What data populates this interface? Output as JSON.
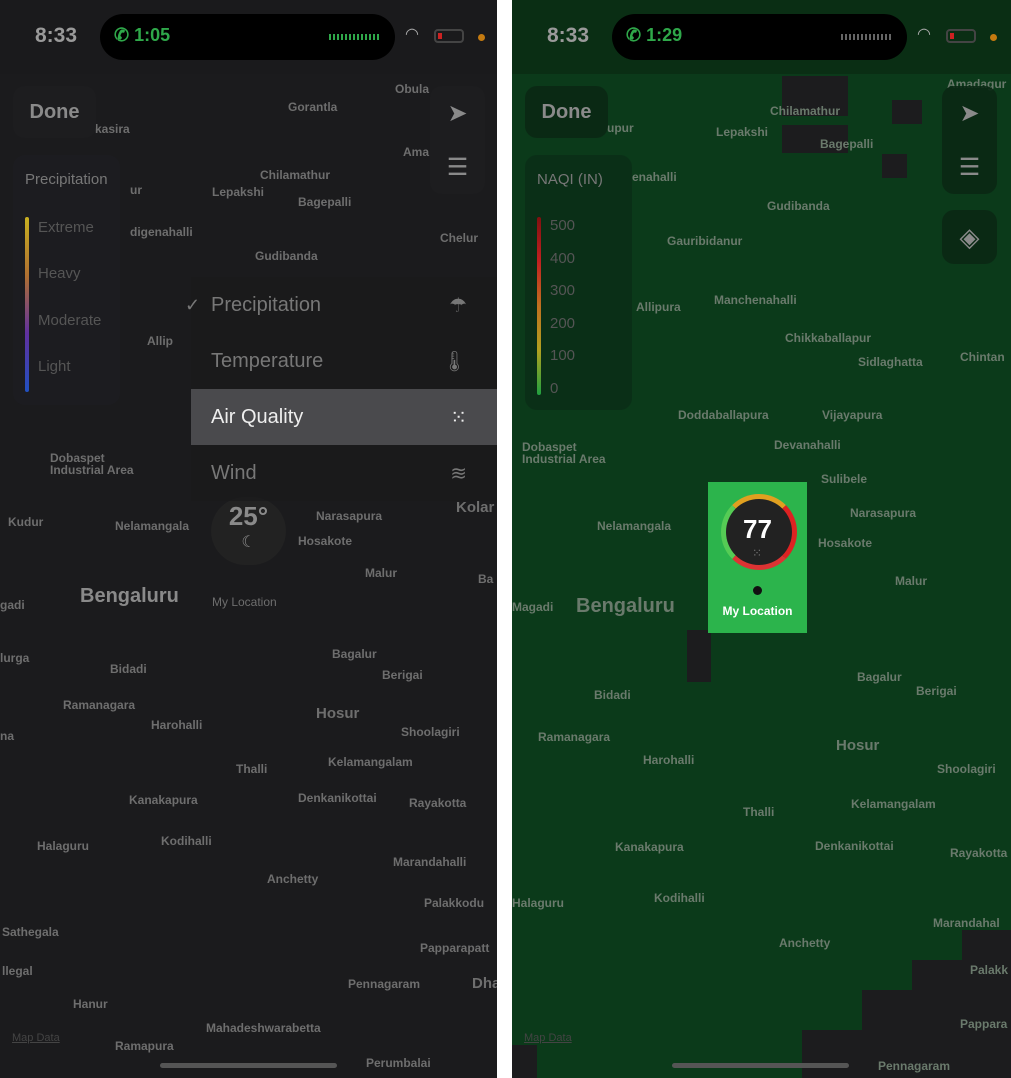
{
  "left": {
    "status": {
      "time": "8:33",
      "call_time": "1:05"
    },
    "done_label": "Done",
    "legend": {
      "title": "Precipitation",
      "levels": [
        "Extreme",
        "Heavy",
        "Moderate",
        "Light"
      ]
    },
    "menu": [
      {
        "label": "Precipitation",
        "checked": true,
        "icon": "umbrella-icon"
      },
      {
        "label": "Temperature",
        "icon": "thermometer-icon"
      },
      {
        "label": "Air Quality",
        "selected": true,
        "icon": "air-quality-dots-icon"
      },
      {
        "label": "Wind",
        "icon": "wind-icon"
      }
    ],
    "pin": {
      "temp": "25°",
      "icon": "moon-stars-icon",
      "label": "My Location"
    },
    "map_data": "Map Data",
    "places": [
      "Obula",
      "Gorantla",
      "kasira",
      "Ama",
      "Chilamathur",
      "Lepakshi",
      "Bagepalli",
      "ur",
      "digenahalli",
      "Chelur",
      "Gudibanda",
      "Allip",
      "Dobaspet",
      "Industrial Area",
      "Kudur",
      "Nelamangala",
      "Narasapura",
      "Kolar",
      "Hosakote",
      "Malur",
      "Ba",
      "Bengaluru",
      "gadi",
      "lurga",
      "Bidadi",
      "Bagalur",
      "Berigai",
      "Ramanagara",
      "Harohalli",
      "Hosur",
      "Shoolagiri",
      "na",
      "Thalli",
      "Kelamangalam",
      "Kanakapura",
      "Denkanikottai",
      "Rayakotta",
      "Halaguru",
      "Kodihalli",
      "Marandahalli",
      "Anchetty",
      "Palakkodu",
      "Sathegala",
      "Papparapatt",
      "llegal",
      "Pennagaram",
      "Dha",
      "Hanur",
      "Mahadeshwarabetta",
      "Ramapura",
      "Perumbalai"
    ]
  },
  "right": {
    "status": {
      "time": "8:33",
      "call_time": "1:29"
    },
    "done_label": "Done",
    "legend": {
      "title": "NAQI (IN)",
      "levels": [
        "500",
        "400",
        "300",
        "200",
        "100",
        "0"
      ]
    },
    "aqi": {
      "value": "77",
      "label": "My Location"
    },
    "map_data": "Map Data",
    "places": [
      "Amadagur",
      "Chilamathur",
      "upur",
      "Lepakshi",
      "Bagepalli",
      "enahalli",
      "Gudibanda",
      "Gauribidanur",
      "Allipura",
      "Manchenahalli",
      "Chikkaballapur",
      "Sidlaghatta",
      "Chintan",
      "Doddaballapura",
      "Vijayapura",
      "Devanahalli",
      "Dobaspet",
      "Industrial Area",
      "Sulibele",
      "Narasapura",
      "Nelamangala",
      "Hosakote",
      "Malur",
      "Bengaluru",
      "Magadi",
      "Bagalur",
      "Berigai",
      "Bidadi",
      "Ramanagara",
      "Hosur",
      "Harohalli",
      "Shoolagiri",
      "Thalli",
      "Kelamangalam",
      "Kanakapura",
      "Denkanikottai",
      "Rayakotta",
      "Halaguru",
      "Kodihalli",
      "Marandahal",
      "Anchetty",
      "Palakk",
      "Pappara",
      "Pennagaram"
    ]
  }
}
